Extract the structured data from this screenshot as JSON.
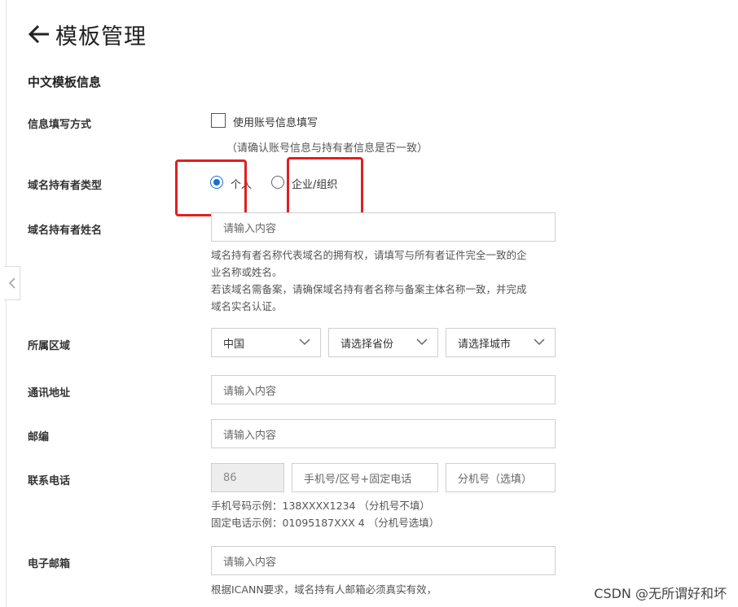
{
  "header": {
    "title": "模板管理"
  },
  "section": {
    "title": "中文模板信息"
  },
  "fill_method": {
    "label": "信息填写方式",
    "checkbox_label": "使用账号信息填写",
    "tip": "（请确认账号信息与持有者信息是否一致）"
  },
  "holder_type": {
    "label": "域名持有者类型",
    "options": [
      "个人",
      "企业/组织"
    ],
    "selected": "个人"
  },
  "holder_name": {
    "label": "域名持有者姓名",
    "placeholder": "请输入内容",
    "help": [
      "域名持有者名称代表域名的拥有权，请填写与所有者证件完全一致的企",
      "业名称或姓名。",
      "若该域名需备案，请确保域名持有者名称与备案主体名称一致，并完成",
      "域名实名认证。"
    ]
  },
  "region": {
    "label": "所属区域",
    "country": "中国",
    "province_placeholder": "请选择省份",
    "city_placeholder": "请选择城市"
  },
  "address": {
    "label": "通讯地址",
    "placeholder": "请输入内容"
  },
  "postcode": {
    "label": "邮编",
    "placeholder": "请输入内容"
  },
  "phone": {
    "label": "联系电话",
    "country_code": "86",
    "number_placeholder": "手机号/区号+固定电话",
    "ext_placeholder": "分机号（选填）",
    "help": [
      "手机号码示例：138XXXX1234 （分机号不填）",
      "固定电话示例：01095187XXX 4 （分机号选填）"
    ]
  },
  "email": {
    "label": "电子邮箱",
    "placeholder": "请输入内容",
    "help": "根据ICANN要求，域名持有人邮箱必须真实有效，"
  },
  "watermark": "CSDN @无所谓好和坏",
  "colors": {
    "accent": "#1a6fd1",
    "annotation": "#e02020"
  }
}
